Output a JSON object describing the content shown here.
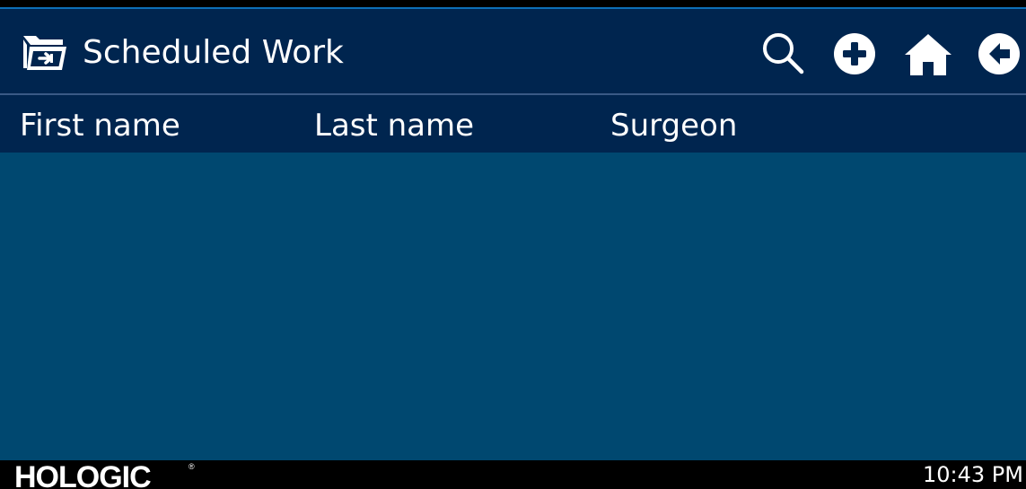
{
  "header": {
    "title": "Scheduled Work",
    "folder_icon": "folder-arrow-icon",
    "actions": [
      {
        "name": "search",
        "icon": "search-icon"
      },
      {
        "name": "add",
        "icon": "plus-circle-icon"
      },
      {
        "name": "home",
        "icon": "home-icon"
      },
      {
        "name": "back",
        "icon": "arrow-left-circle-icon"
      }
    ]
  },
  "table": {
    "columns": [
      "First name",
      "Last name",
      "Surgeon"
    ],
    "rows": []
  },
  "footer": {
    "brand": "HOLOGIC",
    "brand_mark": "®",
    "time": "10:43 PM"
  },
  "colors": {
    "titlebar": "#00254f",
    "content": "#004870",
    "accent": "#0d6fb8",
    "text": "#ffffff",
    "footer": "#000000"
  }
}
